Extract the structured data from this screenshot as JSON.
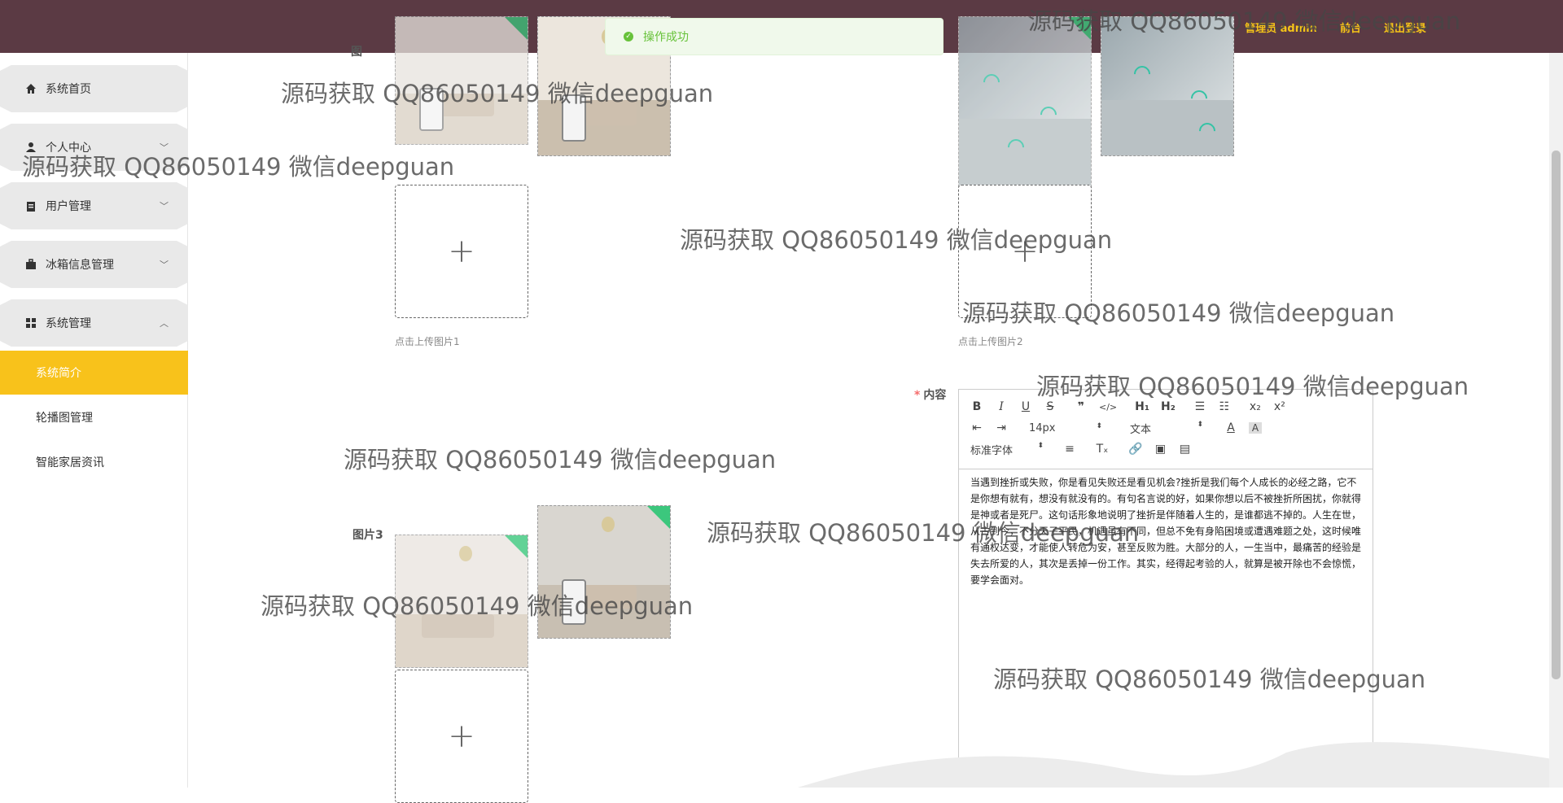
{
  "header": {
    "user_label": "管理员 admin",
    "front_link": "前台",
    "logout_link": "退出登录",
    "bg_color": "#5b3a44",
    "accent_color": "#f5c518"
  },
  "toast": {
    "message": "操作成功",
    "type": "success",
    "icon": "check-circle-icon"
  },
  "sidebar": {
    "items": [
      {
        "label": "系统首页",
        "icon": "home-icon"
      },
      {
        "label": "个人中心",
        "icon": "person-icon"
      },
      {
        "label": "用户管理",
        "icon": "clipboard-icon"
      },
      {
        "label": "冰箱信息管理",
        "icon": "briefcase-icon"
      },
      {
        "label": "系统管理",
        "icon": "grid-icon",
        "expanded": true
      }
    ],
    "submenu": [
      {
        "label": "系统简介",
        "active": true
      },
      {
        "label": "轮播图管理",
        "active": false
      },
      {
        "label": "智能家居资讯",
        "active": false
      }
    ]
  },
  "form": {
    "image1_partial_label": "图",
    "upload_hint_1": "点击上传图片1",
    "upload_hint_2": "点击上传图片2",
    "image3_label": "图片3",
    "content_label": "内容",
    "required_mark": "*"
  },
  "editor": {
    "font_size": "14px",
    "text_type": "文本",
    "font_family": "标准字体",
    "content": "当遇到挫折或失败，你是看见失败还是看见机会?挫折是我们每个人成长的必经之路，它不是你想有就有，想没有就没有的。有句名言说的好，如果你想以后不被挫折所困扰，你就得是神或者是死尸。这句话形象地说明了挫折是伴随着人生的，是谁都逃不掉的。人生在世，从古到今，不分天子平民，机遇虽有不同，但总不免有身陷困境或遭遇难题之处，这时候唯有通权达变，才能使人转危为安，甚至反败为胜。大部分的人，一生当中，最痛苦的经验是失去所爱的人，其次是丢掉一份工作。其实，经得起考验的人，就算是被开除也不会惊慌，要学会面对。"
  },
  "watermark": "源码获取 QQ86050149 微信deepguan"
}
